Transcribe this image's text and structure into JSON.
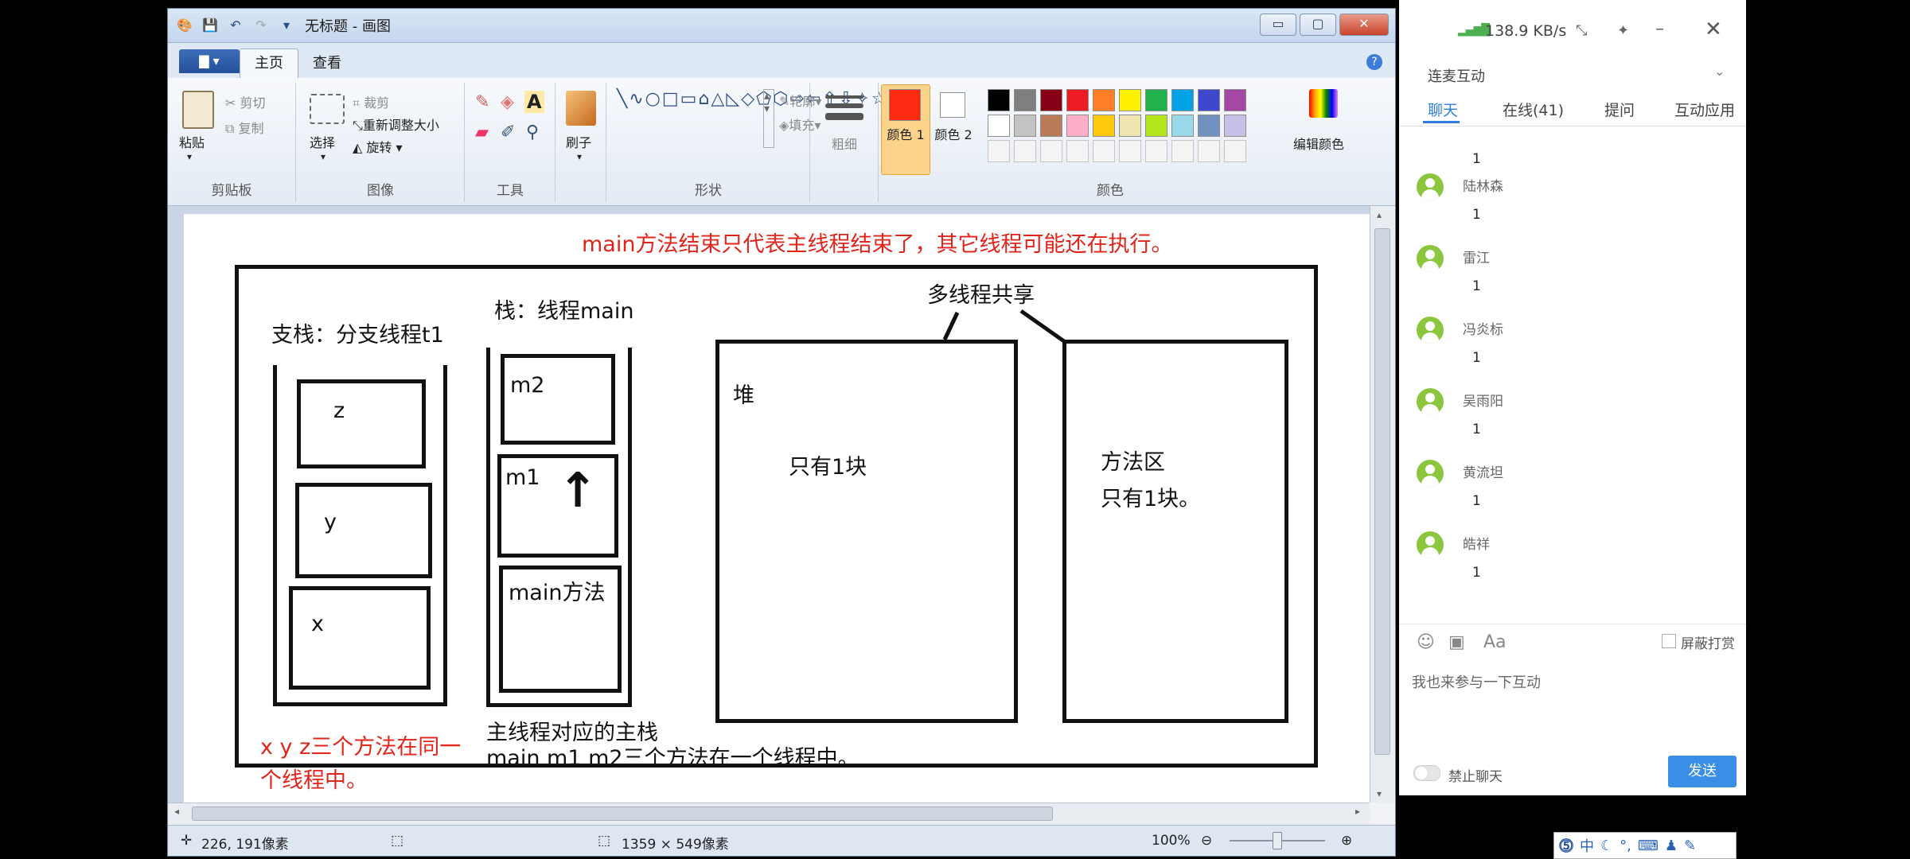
{
  "window": {
    "title": "无标题 - 画图",
    "menu_button": "▇ ▾",
    "tabs": [
      "主页",
      "查看"
    ]
  },
  "ribbon": {
    "clipboard": {
      "paste": "粘贴",
      "cut": "剪切",
      "copy": "复制",
      "group": "剪贴板"
    },
    "image": {
      "select": "选择",
      "crop": "裁剪",
      "resize": "重新调整大小",
      "rotate": "旋转",
      "group": "图像"
    },
    "tools": {
      "group": "工具"
    },
    "brush": {
      "label": "刷子"
    },
    "shapes": {
      "outline": "轮廓",
      "fill": "填充",
      "group": "形状"
    },
    "size": {
      "label": "粗细"
    },
    "colors": {
      "color1": "颜色 1",
      "color2": "颜色 2",
      "edit": "编辑颜色",
      "group": "颜色",
      "color1_value": "#ff2a12",
      "color2_value": "#ffffff",
      "palette_row1": [
        "#000000",
        "#7f7f7f",
        "#880015",
        "#ed1c24",
        "#ff7f27",
        "#fff200",
        "#22b14c",
        "#00a2e8",
        "#3f48cc",
        "#a349a4"
      ],
      "palette_row2": [
        "#ffffff",
        "#c3c3c3",
        "#b97a57",
        "#ffaec9",
        "#ffc90e",
        "#efe4b0",
        "#b5e61d",
        "#99d9ea",
        "#7092be",
        "#c8bfe7"
      ]
    }
  },
  "canvas": {
    "headline": "main方法结束只代表主线程结束了，其它线程可能还在执行。",
    "branch_stack_label": "支栈：分支线程t1",
    "branch_frames": [
      "z",
      "y",
      "x"
    ],
    "main_stack_label": "栈：线程main",
    "main_frames": [
      "m2",
      "m1",
      "main方法"
    ],
    "shared_label": "多线程共享",
    "heap_label": "堆",
    "heap_text": "只有1块",
    "method_area_label": "方法区",
    "method_area_text": "只有1块。",
    "branch_note_line1": "x y z三个方法在同一",
    "branch_note_line2": "个线程中。",
    "main_note_line1": "主线程对应的主栈",
    "main_note_line2": "main m1 m2三个方法在一个线程中。"
  },
  "statusbar": {
    "cursor_pos": "226, 191像素",
    "canvas_size": "1359 × 549像素",
    "zoom": "100%"
  },
  "chat": {
    "network_speed": "138.9 KB/s",
    "section": "连麦互动",
    "tabs": [
      "聊天",
      "在线(41)",
      "提问",
      "互动应用"
    ],
    "messages": [
      {
        "name": "陆林森",
        "text": "1"
      },
      {
        "name": "雷江",
        "text": "1"
      },
      {
        "name": "冯炎标",
        "text": "1"
      },
      {
        "name": "吴雨阳",
        "text": "1"
      },
      {
        "name": "黄流坦",
        "text": "1"
      },
      {
        "name": "皓祥",
        "text": "1"
      }
    ],
    "partial_message_text": "1",
    "block_tips": "屏蔽打赏",
    "input_placeholder": "我也来参与一下互动",
    "mute_label": "禁止聊天",
    "send": "发送"
  },
  "ime": {
    "mode": "中"
  }
}
